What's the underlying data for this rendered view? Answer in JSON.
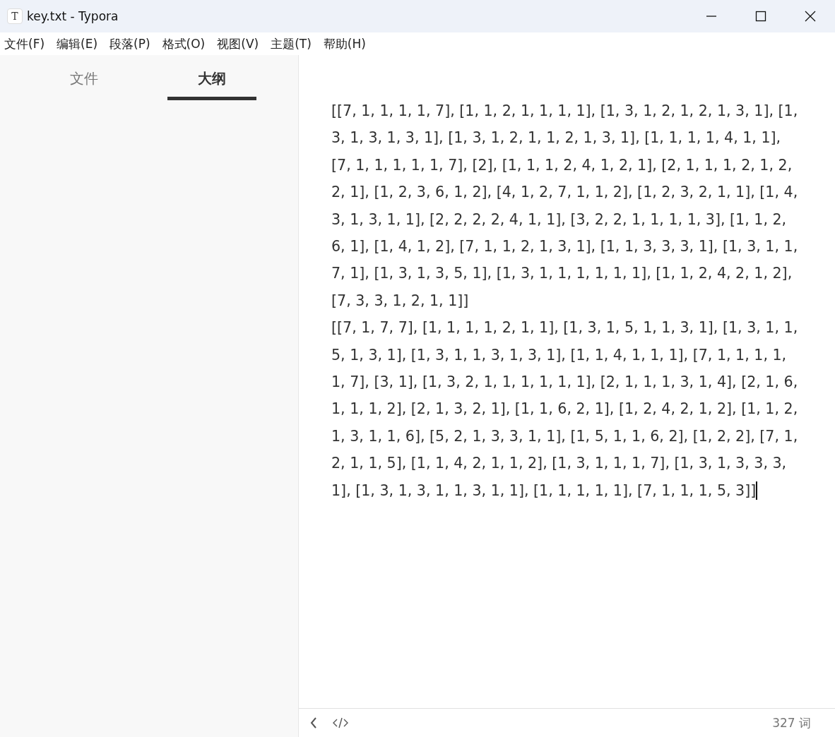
{
  "window": {
    "title": "key.txt - Typora",
    "app_icon": "T"
  },
  "menu": [
    "文件(F)",
    "编辑(E)",
    "段落(P)",
    "格式(O)",
    "视图(V)",
    "主题(T)",
    "帮助(H)"
  ],
  "sidebar": {
    "tabs": [
      {
        "label": "文件",
        "selected": false
      },
      {
        "label": "大纲",
        "selected": true
      }
    ]
  },
  "editor": {
    "paragraphs": [
      "[[7, 1, 1, 1, 1, 7], [1, 1, 2, 1, 1, 1, 1], [1, 3, 1, 2, 1, 2, 1, 3, 1], [1, 3, 1, 3, 1, 3, 1], [1, 3, 1, 2, 1, 1, 2, 1, 3, 1], [1, 1, 1, 1, 4, 1, 1], [7, 1, 1, 1, 1, 1, 7], [2], [1, 1, 1, 2, 4, 1, 2, 1], [2, 1, 1, 1, 2, 1, 2, 2, 1], [1, 2, 3, 6, 1, 2], [4, 1, 2, 7, 1, 1, 2], [1, 2, 3, 2, 1, 1], [1, 4, 3, 1, 3, 1, 1], [2, 2, 2, 2, 4, 1, 1], [3, 2, 2, 1, 1, 1, 1, 3], [1, 1, 2, 6, 1], [1, 4, 1, 2], [7, 1, 1, 2, 1, 3, 1], [1, 1, 3, 3, 3, 1], [1, 3, 1, 1, 7, 1], [1, 3, 1, 3, 5, 1], [1, 3, 1, 1, 1, 1, 1, 1], [1, 1, 2, 4, 2, 1, 2], [7, 3, 3, 1, 2, 1, 1]]",
      "[[7, 1, 7, 7], [1, 1, 1, 1, 2, 1, 1], [1, 3, 1, 5, 1, 1, 3, 1], [1, 3, 1, 1, 5, 1, 3, 1], [1, 3, 1, 1, 3, 1, 3, 1], [1, 1, 4, 1, 1, 1], [7, 1, 1, 1, 1, 1, 7], [3, 1], [1, 3, 2, 1, 1, 1, 1, 1, 1], [2, 1, 1, 1, 3, 1, 4], [2, 1, 6, 1, 1, 1, 2], [2, 1, 3, 2, 1], [1, 1, 6, 2, 1], [1, 2, 4, 2, 1, 2], [1, 1, 2, 1, 3, 1, 1, 6], [5, 2, 1, 3, 3, 1, 1], [1, 5, 1, 1, 6, 2], [1, 2, 2], [7, 1, 2, 1, 1, 5], [1, 1, 4, 2, 1, 1, 2], [1, 3, 1, 1, 1, 7], [1, 3, 1, 3, 3, 3, 1], [1, 3, 1, 3, 1, 1, 3, 1, 1], [1, 1, 1, 1, 1], [7, 1, 1, 1, 5, 3]]"
    ]
  },
  "status_bar": {
    "word_count": "327 词"
  }
}
